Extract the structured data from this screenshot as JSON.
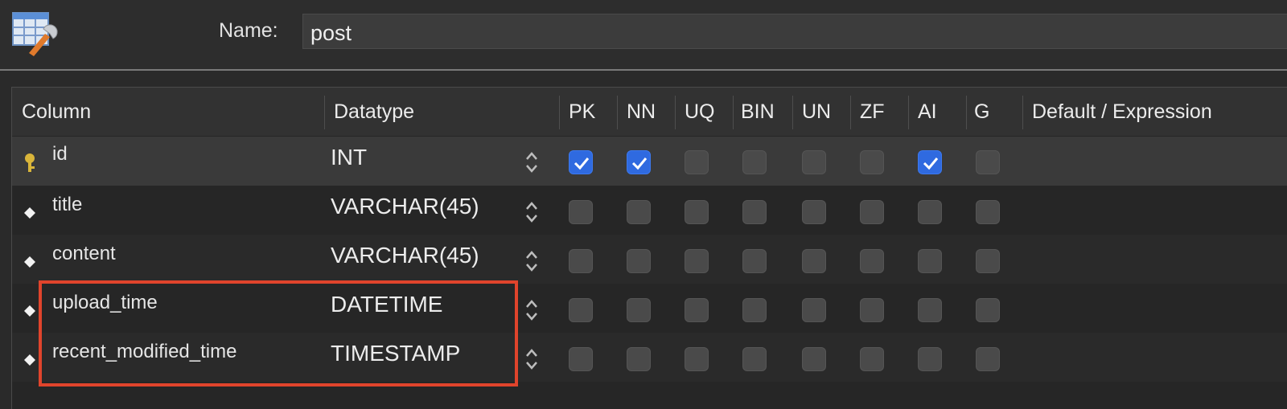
{
  "header": {
    "name_label": "Name:",
    "name_value": "post"
  },
  "columns_header": {
    "column": "Column",
    "datatype": "Datatype",
    "flags": [
      "PK",
      "NN",
      "UQ",
      "BIN",
      "UN",
      "ZF",
      "AI",
      "G"
    ],
    "default": "Default / Expression"
  },
  "rows": [
    {
      "name": "id",
      "datatype": "INT",
      "icon": "primary-key-icon",
      "flags": [
        true,
        true,
        false,
        false,
        false,
        false,
        true,
        false
      ]
    },
    {
      "name": "title",
      "datatype": "VARCHAR(45)",
      "icon": "column-diamond-icon",
      "flags": [
        false,
        false,
        false,
        false,
        false,
        false,
        false,
        false
      ]
    },
    {
      "name": "content",
      "datatype": "VARCHAR(45)",
      "icon": "column-diamond-icon",
      "flags": [
        false,
        false,
        false,
        false,
        false,
        false,
        false,
        false
      ]
    },
    {
      "name": "upload_time",
      "datatype": "DATETIME",
      "icon": "column-diamond-icon",
      "flags": [
        false,
        false,
        false,
        false,
        false,
        false,
        false,
        false
      ]
    },
    {
      "name": "recent_modified_time",
      "datatype": "TIMESTAMP",
      "icon": "column-diamond-icon",
      "flags": [
        false,
        false,
        false,
        false,
        false,
        false,
        false,
        false
      ]
    }
  ],
  "colors": {
    "checkbox_on": "#2f6ae0",
    "highlight": "#e0442c",
    "key_icon": "#d9b53a"
  }
}
